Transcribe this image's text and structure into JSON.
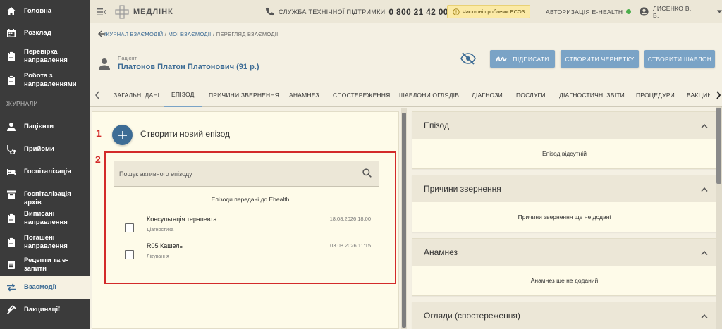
{
  "app": {
    "brand": "МЕДЛІНК"
  },
  "topbar": {
    "support_label": "СЛУЖБА ТЕХНІЧНОЇ ПІДТРИМКИ",
    "support_phone": "0 800 21 42 00",
    "warning": "Часткові проблеми ЕСОЗ",
    "auth_label": "АВТОРИЗАЦІЯ E-HEALTH",
    "user_name": "ЛИСЕНКО В. В."
  },
  "sidebar": {
    "section_label": "ЖУРНАЛИ",
    "items": [
      {
        "label": "Головна"
      },
      {
        "label": "Розклад"
      },
      {
        "label": "Перевірка направлення"
      },
      {
        "label": "Робота з направленнями"
      },
      {
        "label": "Пацієнти"
      },
      {
        "label": "Прийоми"
      },
      {
        "label": "Госпіталізація"
      },
      {
        "label": "Госпіталізація архів"
      },
      {
        "label": "Виписані направлення"
      },
      {
        "label": "Погашені направлення"
      },
      {
        "label": "Рецепти та е-запити"
      },
      {
        "label": "Взаємодії"
      },
      {
        "label": "Вакцинації"
      }
    ]
  },
  "breadcrumb": {
    "journal": "ЖУРНАЛ ВЗАЄМОДІЙ",
    "mine": "МОЇ ВЗАЄМОДІЇ",
    "current": "ПЕРЕГЛЯД ВЗАЄМОДІЇ",
    "sep": "/"
  },
  "patient": {
    "label": "Пацієнт",
    "name": "Платонов Платон Платонович (91 р.)"
  },
  "actions": {
    "sign": "ПІДПИСАТИ",
    "draft": "СТВОРИТИ ЧЕРНЕТКУ",
    "template": "СТВОРИТИ ШАБЛОН"
  },
  "tabs": [
    {
      "label": "ЗАГАЛЬНІ ДАНІ"
    },
    {
      "label": "ЕПІЗОД"
    },
    {
      "label": "ПРИЧИНИ ЗВЕРНЕННЯ"
    },
    {
      "label": "АНАМНЕЗ"
    },
    {
      "label": "СПОСТЕРЕЖЕННЯ"
    },
    {
      "label": "ШАБЛОНИ ОГЛЯДІВ"
    },
    {
      "label": "ДІАГНОЗИ"
    },
    {
      "label": "ПОСЛУГИ"
    },
    {
      "label": "ДІАГНОСТИЧНІ ЗВІТИ"
    },
    {
      "label": "ПРОЦЕДУРИ"
    },
    {
      "label": "ВАКЦИН"
    }
  ],
  "episode_panel": {
    "marker_1": "1",
    "marker_2": "2",
    "create_label": "Створити новий епізод",
    "search_placeholder": "Пошук активного епізоду",
    "list_title": "Епізоди передані до Ehealth",
    "episodes": [
      {
        "name": "Консультація терапевта",
        "date": "18.08.2026 18:00",
        "type": "Діагностика"
      },
      {
        "name": "R05 Кашель",
        "date": "03.08.2026 11:15",
        "type": "Лікування"
      }
    ]
  },
  "cards": [
    {
      "title": "Епізод",
      "body": "Епізод відсутній"
    },
    {
      "title": "Причини звернення",
      "body": "Причини звернення ще не додані"
    },
    {
      "title": "Анамнез",
      "body": "Анамнез ще не доданий"
    },
    {
      "title": "Огляди (спостереження)",
      "body": ""
    }
  ],
  "colors": {
    "accent": "#3d6c95",
    "button": "#7aa3c6",
    "highlight": "#d32a2a",
    "sidebar": "#3b3b3b"
  }
}
